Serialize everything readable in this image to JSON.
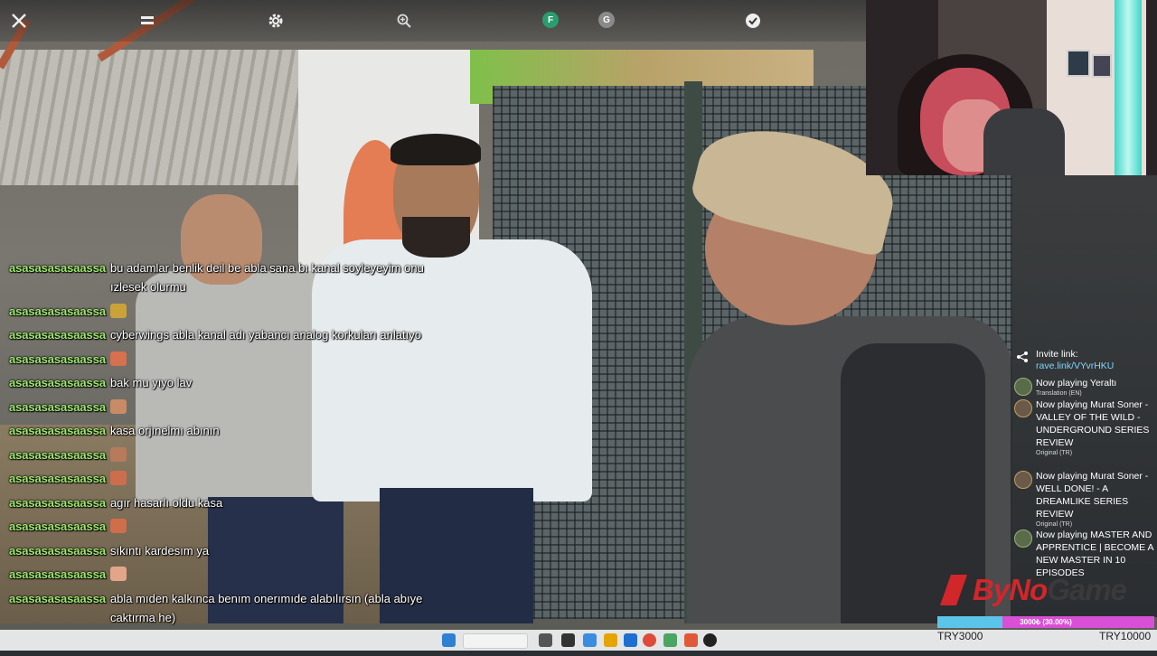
{
  "toolbar": {
    "icons": [
      "close-icon",
      "menu-icon",
      "gear-icon",
      "zoom-icon",
      "f-badge-icon",
      "g-badge-icon",
      "check-icon"
    ],
    "badge_f": "F",
    "badge_g": "G"
  },
  "chat": {
    "messages": [
      {
        "user": "asasasasasaassa",
        "text": "bu adamlar benlik deil be abla sana bı kanal soyleyeyim onu ızlesek olurmu"
      },
      {
        "user": "asasasasasaassa",
        "emote": "flag-emote",
        "emote_color": "#caa23a"
      },
      {
        "user": "asasasasasaassa",
        "text": "cyberwings abla kanal adı yabancı analog korkuları anlatıyo"
      },
      {
        "user": "asasasasasaassa",
        "emote": "face-emote",
        "emote_color": "#d6704e"
      },
      {
        "user": "asasasasasaassa",
        "text": "bak mu yıyo lav"
      },
      {
        "user": "asasasasasaassa",
        "emote": "face-emote",
        "emote_color": "#c98a66"
      },
      {
        "user": "asasasasasaassa",
        "text": "kasa orjınelmı abının"
      },
      {
        "user": "asasasasasaassa",
        "emote": "face-emote",
        "emote_color": "#b77a5a"
      },
      {
        "user": "asasasasasaassa",
        "emote": "face-emote",
        "emote_color": "#cc6e4e"
      },
      {
        "user": "asasasasasaassa",
        "text": "agır hasarlı oldu kasa"
      },
      {
        "user": "asasasasasaassa",
        "emote": "face-emote",
        "emote_color": "#cf6e4a"
      },
      {
        "user": "asasasasasaassa",
        "text": "sıkıntı kardesım ya"
      },
      {
        "user": "asasasasasaassa",
        "emote": "hand-emote",
        "emote_color": "#e3a58a"
      },
      {
        "user": "asasasasasaassa",
        "text": "abla mıden kalkınca benım onerımıde alabılırsın (abla abıye caktırma he)"
      },
      {
        "user": "asasasasasaassa",
        "emote": "face-emote",
        "emote_color": "#d26a48"
      }
    ]
  },
  "invite": {
    "label": "Invite link: ",
    "link": "rave.link/VYvrHKU"
  },
  "now_playing": [
    {
      "title": "Now playing Yeraltı",
      "subtitle": "Translation (EN)"
    },
    {
      "title": "Now playing Murat Soner - VALLEY OF THE WILD - UNDERGROUND SERIES REVIEW",
      "subtitle": "Original (TR)"
    },
    {
      "title": "Now playing Murat Soner - WELL DONE! - A DREAMLIKE SERIES REVIEW",
      "subtitle": "Original (TR)"
    },
    {
      "title": "Now playing MASTER AND APPRENTICE | BECOME A NEW MASTER IN 10 EPISODES",
      "subtitle": ""
    }
  ],
  "logo": {
    "prefix": "ByNo",
    "suffix": "Game"
  },
  "donation": {
    "label": "3000₺ (30.00%)",
    "progress_percent": 30,
    "left_label": "TRY3000",
    "right_label": "TRY10000"
  },
  "colors": {
    "username": "#9fe870",
    "link": "#7fd6ff",
    "brand": "#d1262a",
    "donation_base": "#5cc4e8",
    "donation_fill": "#d94fd6"
  }
}
